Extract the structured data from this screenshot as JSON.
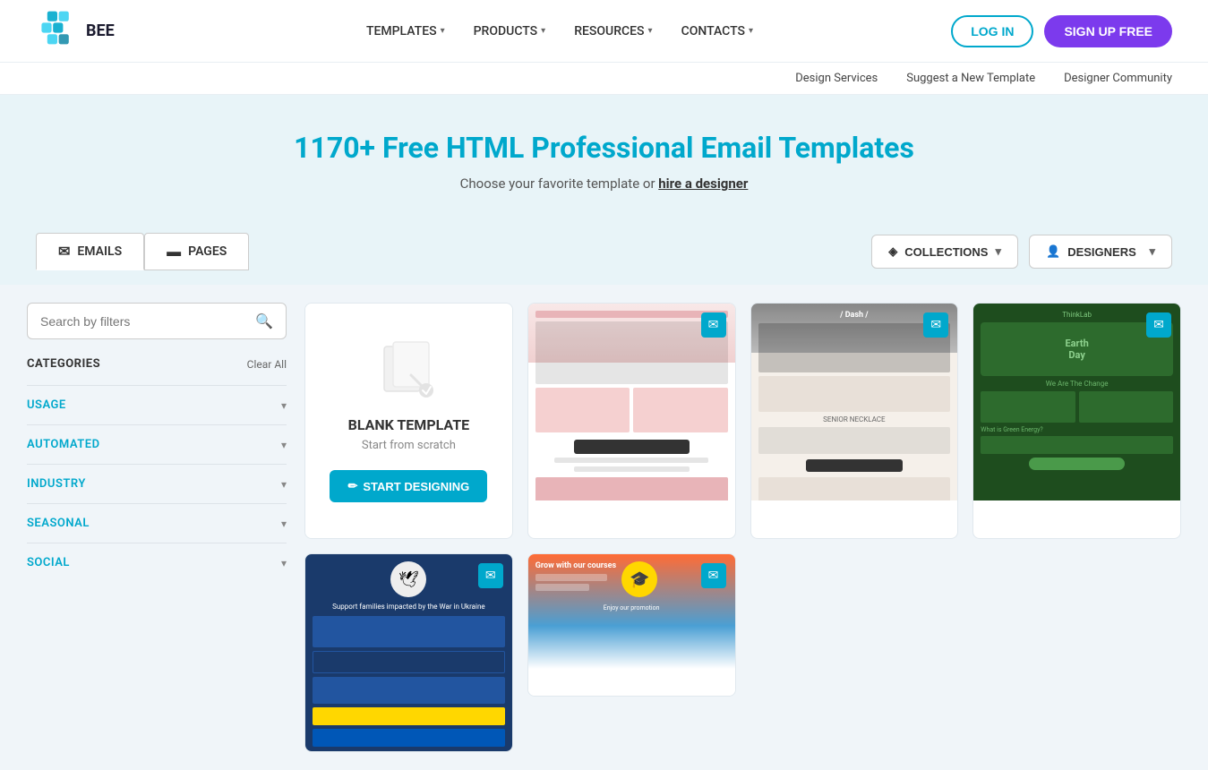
{
  "header": {
    "logo_text": "BEE",
    "nav": [
      {
        "label": "TEMPLATES",
        "has_dropdown": true
      },
      {
        "label": "PRODUCTS",
        "has_dropdown": true
      },
      {
        "label": "RESOURCES",
        "has_dropdown": true
      },
      {
        "label": "CONTACTS",
        "has_dropdown": true
      }
    ],
    "btn_login": "LOG IN",
    "btn_signup": "SIGN UP FREE"
  },
  "sub_nav": {
    "links": [
      {
        "label": "Design Services"
      },
      {
        "label": "Suggest a New Template"
      },
      {
        "label": "Designer Community"
      }
    ]
  },
  "hero": {
    "title": "1170+ Free HTML Professional Email Templates",
    "subtitle": "Choose your favorite template or",
    "hire_link": "hire a designer"
  },
  "toolbar": {
    "tabs": [
      {
        "label": "EMAILS",
        "icon": "✉",
        "active": true
      },
      {
        "label": "PAGES",
        "icon": "▬",
        "active": false
      }
    ],
    "dropdowns": [
      {
        "label": "COLLECTIONS",
        "icon": "◈"
      },
      {
        "label": "DESIGNERS",
        "icon": "👤"
      }
    ]
  },
  "sidebar": {
    "search_placeholder": "Search by filters",
    "categories_label": "CATEGORIES",
    "clear_all_label": "Clear All",
    "filters": [
      {
        "label": "USAGE"
      },
      {
        "label": "AUTOMATED"
      },
      {
        "label": "INDUSTRY"
      },
      {
        "label": "SEASONAL"
      },
      {
        "label": "SOCIAL"
      }
    ]
  },
  "templates": {
    "blank": {
      "title": "BLANK TEMPLATE",
      "subtitle": "Start from scratch",
      "btn_label": "START DESIGNING"
    },
    "cards": [
      {
        "id": 1,
        "type": "pink",
        "has_badge": true
      },
      {
        "id": 2,
        "type": "fashion",
        "has_badge": true
      },
      {
        "id": 3,
        "type": "green",
        "has_badge": true
      },
      {
        "id": 4,
        "type": "ukraine",
        "has_badge": true
      },
      {
        "id": 5,
        "type": "edu",
        "has_badge": true
      }
    ]
  }
}
